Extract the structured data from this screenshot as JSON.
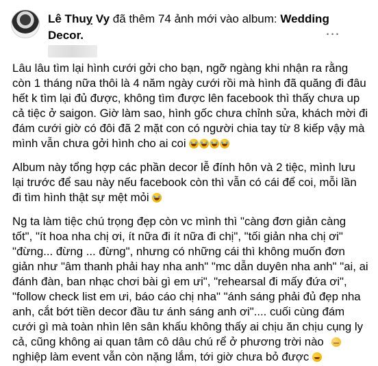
{
  "post": {
    "author": "Lê Thuỵ Vy",
    "action_text": "đã thêm 74 ảnh mới vào album:",
    "album_title": "Wedding Decor.",
    "more_icon": "more-icon",
    "avatar_icon": "avatar"
  },
  "content": {
    "paragraph1": "Lâu lâu tìm lại hình cưới gởi cho bạn, ngỡ ngàng khi nhận ra rằng còn 1 tháng nữa thôi là 4 năm ngày cưới rồi mà hình đã quăng đi đâu hết k tìm lại đủ được, không tìm được lên facebook thì thấy chưa up cả tiệc ở saigon. Giờ làm sao, hình gốc chưa chỉnh sửa, khách mời đi đám cưới giờ có đôi đã 2 mặt con có người chia tay từ 8 kiếp vậy mà mình vẫn chưa gởi hình cho ai coi",
    "paragraph2": "Album này tổng hợp các phần decor lễ đính hôn và 2 tiệc, mình lưu lại trước để sau này nếu facebook còn thì vẫn có cái để coi, mỗi lần đi tìm hình thật sự mệt mỏi",
    "paragraph3": "Ng ta làm tiệc chú trọng đẹp còn vc mình thì \"càng đơn giản càng tốt\", \"ít hoa nha chị ơi, ít nữa đi ít nữa đi chị\", \"tối giản nha chị ơi\" \"đừng... đừng ... đừng\", nhưng có những cái thì không muốn đơn giản như \"âm thanh phải hay nha anh\" \"mc dẫn duyên nha anh\" \"ai, ai đánh đàn, ban nhạc chơi bài gì em ưi\", \"rehearsal đi mấy đứa ơi\", \"follow check list em ưi, báo cáo chị nha\" \"ánh sáng phải đủ đẹp nha anh, cắt bớt tiền decor đầu tư ánh sáng anh ơi\".... cuối cùng đám cưới gì mà toàn nhìn lên sân khấu không thấy ai chịu ăn chịu cụng ly cả, cũng không ai quan tâm cô dâu chú rể ở phương trời nào",
    "paragraph3_end": "nghiệp làm event vẫn còn nặng lắm, tới giờ chưa bỏ được"
  },
  "colors": {
    "text": "#050505",
    "muted": "#65676b",
    "emoji": "#f3b300"
  }
}
